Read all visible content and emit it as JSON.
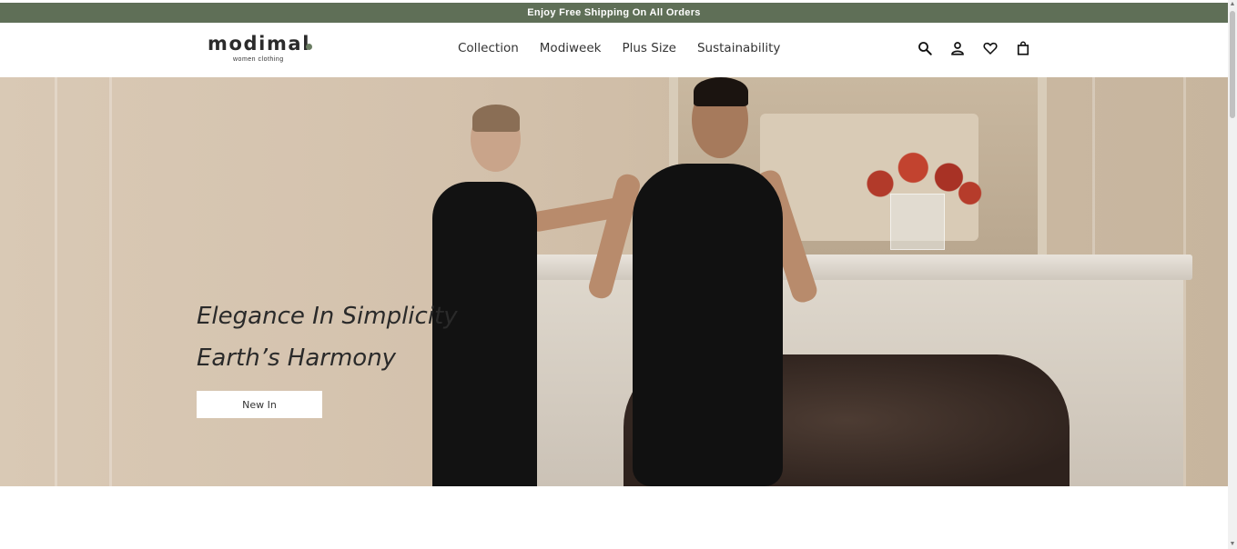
{
  "announcement": {
    "text": "Enjoy Free Shipping On All Orders"
  },
  "brand": {
    "name": "modimal",
    "tagline": "women clothing",
    "accent": "#5f6f57"
  },
  "nav": {
    "items": [
      {
        "label": "Collection"
      },
      {
        "label": "Modiweek"
      },
      {
        "label": "Plus Size"
      },
      {
        "label": "Sustainability"
      }
    ]
  },
  "header_icons": [
    "search-icon",
    "account-icon",
    "wishlist-icon",
    "cart-icon"
  ],
  "hero": {
    "line1": "Elegance In Simplicity",
    "line2": "Earth’s Harmony",
    "cta_label": "New In"
  }
}
